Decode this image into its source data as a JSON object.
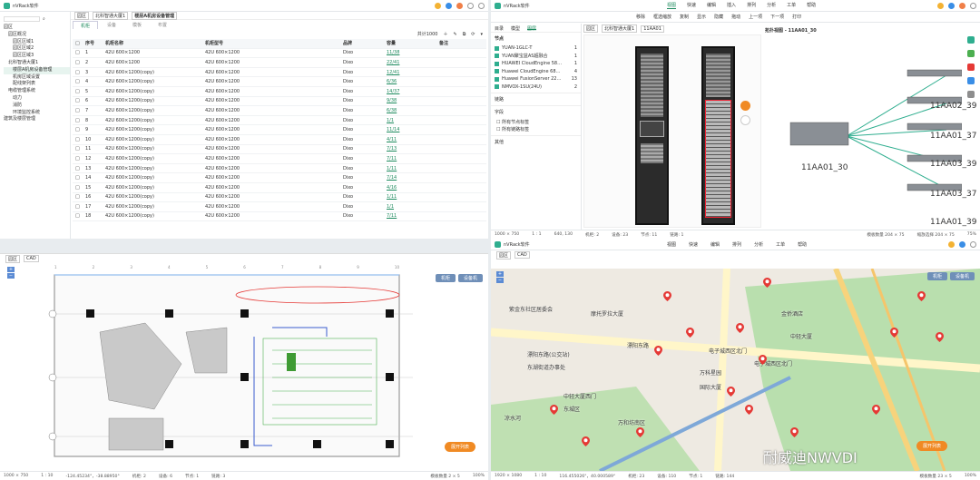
{
  "q1": {
    "app_title": "nVRack软件",
    "breadcrumb": [
      "园区",
      "北科智通大厦1",
      "楼层A机房设备管理"
    ],
    "tabs": [
      "机柜",
      "设备",
      "模板",
      "布置"
    ],
    "tree": [
      "园区",
      "园区概况",
      "园区区域1",
      "园区区域2",
      "园区区域3",
      "北科智通大厦1",
      "楼层A机房设备管理",
      "机房区域设置",
      "配线架列表",
      "电缆管理系统",
      "动力",
      "消防",
      "环境监控系统",
      "建筑及楼层管理"
    ],
    "page_label": "共计1000",
    "columns": [
      "序号",
      "机柜名称",
      "机柜型号",
      "品牌",
      "容量",
      "备注"
    ],
    "rows": [
      [
        "1",
        "42U 600×1200",
        "42U 600×1200",
        "Dixo",
        "11/38"
      ],
      [
        "2",
        "42U 600×1200",
        "42U 600×1200",
        "Dixo",
        "22/41"
      ],
      [
        "3",
        "42U 600×1200(copy)",
        "42U 600×1200",
        "Dixo",
        "12/41"
      ],
      [
        "4",
        "42U 600×1200(copy)",
        "42U 600×1200",
        "Dixo",
        "6/36"
      ],
      [
        "5",
        "42U 600×1200(copy)",
        "42U 600×1200",
        "Dixo",
        "14/37"
      ],
      [
        "6",
        "42U 600×1200(copy)",
        "42U 600×1200",
        "Dixo",
        "9/38"
      ],
      [
        "7",
        "42U 600×1200(copy)",
        "42U 600×1200",
        "Dixo",
        "6/38"
      ],
      [
        "8",
        "42U 600×1200(copy)",
        "42U 600×1200",
        "Dixo",
        "1/1"
      ],
      [
        "9",
        "42U 600×1200(copy)",
        "42U 600×1200",
        "Dixo",
        "11/14"
      ],
      [
        "10",
        "42U 600×1200(copy)",
        "42U 600×1200",
        "Dixo",
        "4/11"
      ],
      [
        "11",
        "42U 600×1200(copy)",
        "42U 600×1200",
        "Dixo",
        "7/13"
      ],
      [
        "12",
        "42U 600×1200(copy)",
        "42U 600×1200",
        "Dixo",
        "7/11"
      ],
      [
        "13",
        "42U 600×1200(copy)",
        "42U 600×1200",
        "Dixo",
        "1/11"
      ],
      [
        "14",
        "42U 600×1200(copy)",
        "42U 600×1200",
        "Dixo",
        "7/14"
      ],
      [
        "15",
        "42U 600×1200(copy)",
        "42U 600×1200",
        "Dixo",
        "4/16"
      ],
      [
        "16",
        "42U 600×1200(copy)",
        "42U 600×1200",
        "Dixo",
        "1/11"
      ],
      [
        "17",
        "42U 600×1200(copy)",
        "42U 600×1200",
        "Dixo",
        "1/1"
      ],
      [
        "18",
        "42U 600×1200(copy)",
        "42U 600×1200",
        "Dixo",
        "7/11"
      ]
    ]
  },
  "q2": {
    "app_title": "nVRack软件",
    "menu": [
      "视图",
      "快速",
      "编辑",
      "插入",
      "排列",
      "分析",
      "工单",
      "帮助"
    ],
    "active_menu": "视图",
    "toolbar": [
      "移除",
      "框选缩放",
      "复制",
      "显示",
      "隐藏",
      "拖动",
      "上一项",
      "下一项",
      "打印"
    ],
    "sidebar_tabs": [
      "目录",
      "模型",
      "图层"
    ],
    "section_devices": "节点",
    "devices": [
      [
        "YUAN-1GLC-T",
        "1"
      ],
      [
        "YUAN聚宝盆AS超融合",
        "1"
      ],
      [
        "HUAWEI CloudEngine 58…",
        "1"
      ],
      [
        "Huawei CloudEngine 68…",
        "4"
      ],
      [
        "Huawei FusionServer 22…",
        "13"
      ],
      [
        "NMVOX-1SU(24U)",
        "2"
      ]
    ],
    "section_links": "链路",
    "section_fields": "字段",
    "fields": [
      "所有节点标签",
      "所有链路标签"
    ],
    "section_other": "其他",
    "breadcrumb": [
      "园区",
      "北科智通大厦1",
      "11AA01"
    ],
    "topology_title": "拓扑视图 - 11AA01_30",
    "nodes": [
      "11AA02_39",
      "11AA01_37",
      "11AA01_30",
      "11AA03_39",
      "11AA03_37",
      "11AA01_39"
    ],
    "status": [
      "1000 × 750",
      "1 : 1",
      "640, 130",
      "机柜: 2",
      "设备: 23",
      "节点: 11",
      "链路: 1"
    ],
    "status_right": [
      "模板数量 204 × 75",
      "缩放选择 204 × 75",
      "75%"
    ]
  },
  "q3": {
    "breadcrumb": [
      "园区",
      "CAD"
    ],
    "btn_cabinet": "机柜",
    "btn_equipment": "设备机",
    "orange_button": "展开列表",
    "axis": [
      "1",
      "2",
      "3",
      "4",
      "5",
      "6",
      "7",
      "8",
      "9",
      "10"
    ],
    "status": [
      "1000 × 750",
      "1 : 10",
      "-124.45234°，-38.88950°",
      "机柜: 2",
      "设备: 6",
      "节点: 1",
      "链路: 3"
    ],
    "status_right": [
      "模板数量 2 × 5",
      "100%"
    ]
  },
  "q4": {
    "app_title": "nVRack软件",
    "menu": [
      "视图",
      "快速",
      "编辑",
      "排列",
      "分析",
      "工单",
      "帮助"
    ],
    "breadcrumb": [
      "园区",
      "CAD"
    ],
    "btn_cabinet": "机柜",
    "btn_equipment": "设备机",
    "orange_button": "展开列表",
    "map_labels": [
      "紫金东社区居委会",
      "摩托罗拉大厦",
      "漂阳东路",
      "电子城西区北门",
      "中轻大厦",
      "金侨酒店",
      "漂阳东路(公交站)",
      "东湖街道办事处",
      "万科星园",
      "电子城西区北门",
      "中轻大厦西门",
      "国际大厦",
      "东城区",
      "万和坊南区",
      "凉水河"
    ],
    "watermark": "耐威迪NWVDI",
    "status": [
      "1920 × 1080",
      "1 : 10",
      "116.455026°，40.000589°",
      "机柜: 23",
      "设备: 110",
      "节点: 1",
      "链路: 144"
    ],
    "status_right": [
      "模板数量 23 × 5",
      "100%"
    ]
  },
  "colors": {
    "accent": "#1d8a5e",
    "orange": "#f08a24",
    "map_green": "#b9dfae",
    "map_road": "#fff6c9"
  }
}
